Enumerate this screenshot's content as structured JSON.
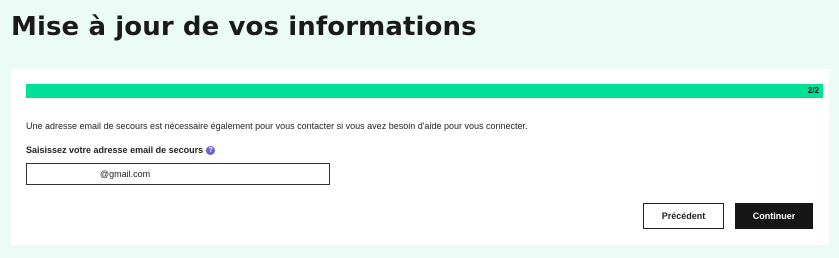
{
  "header": {
    "title": "Mise à jour de vos informations"
  },
  "progress": {
    "label": "2/2",
    "fraction": 1.0,
    "color": "#00e096"
  },
  "form": {
    "info_text": "Une adresse email de secours est nécessaire également pour vous contacter si vous avez besoin d'aide pour vous connecter.",
    "field_label": "Saisissez votre adresse email de secours",
    "help_icon": "question-circle-icon",
    "help_glyph": "?",
    "email_value": "@gmail.com"
  },
  "buttons": {
    "previous_label": "Précédent",
    "continue_label": "Continuer"
  },
  "colors": {
    "background": "#ebfbf5",
    "accent": "#00e096",
    "help_icon": "#6a63d9",
    "primary_button": "#161616"
  }
}
